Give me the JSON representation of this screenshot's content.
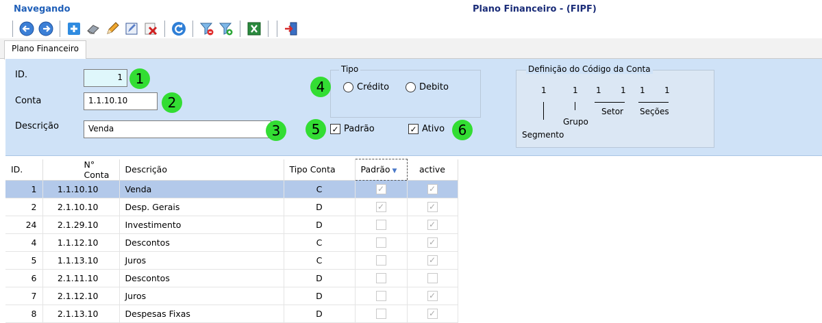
{
  "status": "Navegando",
  "title": "Plano Financeiro - (FIPF)",
  "toolbar": {
    "buttons": [
      {
        "icon": "arrow-left-icon"
      },
      {
        "icon": "arrow-right-icon"
      },
      {
        "icon": "plus-icon"
      },
      {
        "icon": "eraser-icon"
      },
      {
        "icon": "pencil-icon"
      },
      {
        "icon": "edit-icon"
      },
      {
        "icon": "delete-icon"
      },
      {
        "icon": "refresh-icon"
      },
      {
        "icon": "filter-remove-icon"
      },
      {
        "icon": "filter-add-icon"
      },
      {
        "icon": "excel-icon"
      },
      {
        "icon": "exit-icon"
      }
    ]
  },
  "tab": {
    "label": "Plano Financeiro"
  },
  "form": {
    "id_label": "ID.",
    "id_value": "1",
    "conta_label": "Conta",
    "conta_value": "1.1.10.10",
    "descricao_label": "Descrição",
    "descricao_value": "Venda",
    "tipo_label": "Tipo",
    "tipo_credito": "Crédito",
    "tipo_debito": "Debito",
    "padrao_label": "Padrão",
    "padrao_checked": true,
    "ativo_label": "Ativo",
    "ativo_checked": true,
    "badges": [
      "1",
      "2",
      "3",
      "4",
      "5",
      "6"
    ]
  },
  "definicao": {
    "title": "Definição do Código da Conta",
    "digits": [
      "1",
      "1",
      "1",
      "1",
      "1",
      "1"
    ],
    "segmento": "Segmento",
    "grupo": "Grupo",
    "setor": "Setor",
    "secoes": "Seções"
  },
  "grid": {
    "headers": [
      "ID.",
      "N° Conta",
      "Descrição",
      "Tipo Conta",
      "Padrão",
      "active"
    ],
    "rows": [
      {
        "id": "1",
        "conta": "1.1.10.10",
        "desc": "Venda",
        "tipo": "C",
        "padrao": true,
        "active": true
      },
      {
        "id": "2",
        "conta": "2.1.10.10",
        "desc": "Desp. Gerais",
        "tipo": "D",
        "padrao": true,
        "active": true
      },
      {
        "id": "24",
        "conta": "2.1.29.10",
        "desc": "Investimento",
        "tipo": "D",
        "padrao": false,
        "active": true
      },
      {
        "id": "4",
        "conta": "1.1.12.10",
        "desc": "Descontos",
        "tipo": "C",
        "padrao": false,
        "active": true
      },
      {
        "id": "5",
        "conta": "1.1.13.10",
        "desc": "Juros",
        "tipo": "C",
        "padrao": false,
        "active": true
      },
      {
        "id": "6",
        "conta": "2.1.11.10",
        "desc": "Descontos",
        "tipo": "D",
        "padrao": false,
        "active": false
      },
      {
        "id": "7",
        "conta": "2.1.12.10",
        "desc": "Juros",
        "tipo": "D",
        "padrao": false,
        "active": true
      },
      {
        "id": "8",
        "conta": "2.1.13.10",
        "desc": "Despesas Fixas",
        "tipo": "D",
        "padrao": false,
        "active": true
      }
    ]
  }
}
